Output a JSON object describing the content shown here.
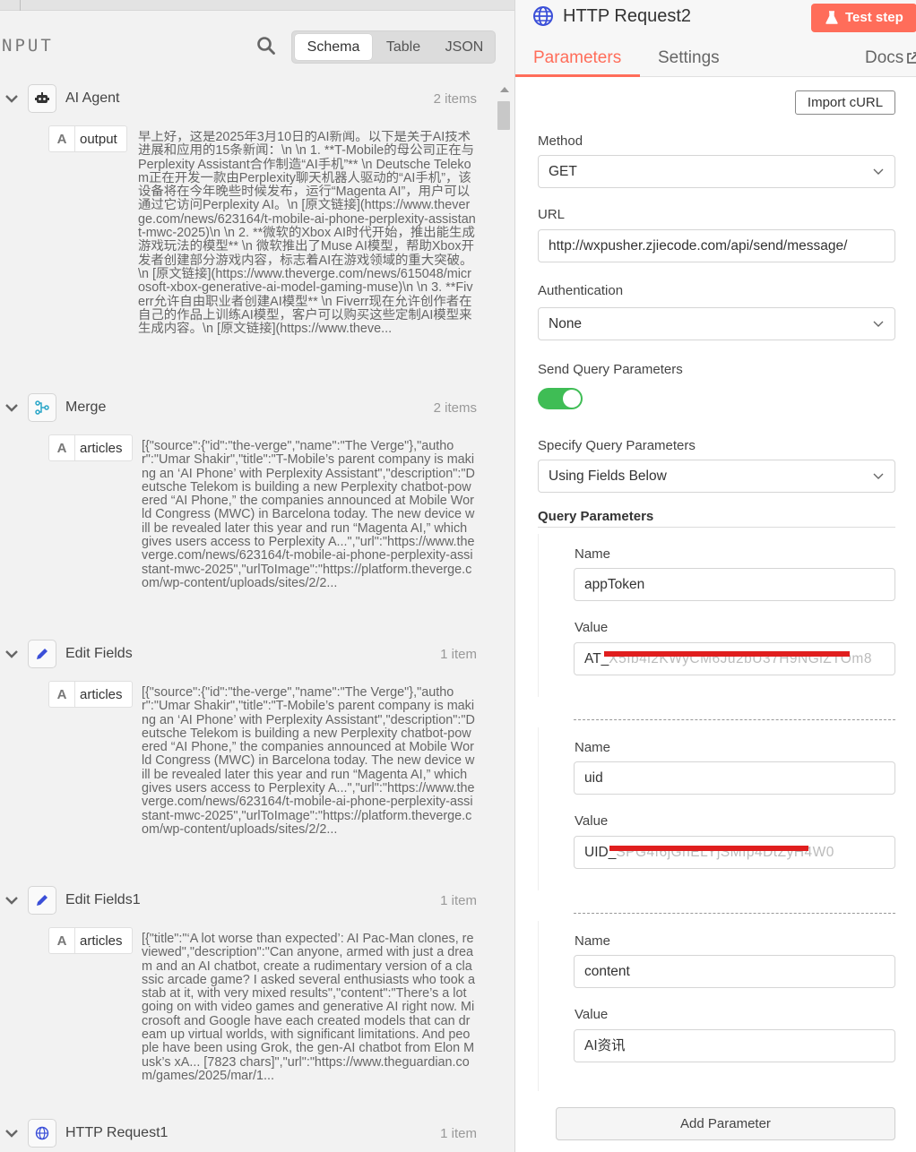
{
  "input_panel": {
    "title": "NPUT",
    "view_tabs": [
      "Schema",
      "Table",
      "JSON"
    ],
    "active_view": "Schema",
    "nodes": [
      {
        "name": "AI Agent",
        "count": "2 items",
        "icon": "robot-icon",
        "field": "output",
        "value": "早上好，这是2025年3月10日的AI新闻。以下是关于AI技术进展和应用的15条新闻：\\n \\n 1. **T-Mobile的母公司正在与Perplexity Assistant合作制造“AI手机”** \\n Deutsche Telekom正在开发一款由Perplexity聊天机器人驱动的“AI手机”，该设备将在今年晚些时候发布，运行“Magenta AI”，用户可以通过它访问Perplexity AI。\\n [原文链接](https://www.theverge.com/news/623164/t-mobile-ai-phone-perplexity-assistant-mwc-2025)\\n \\n 2. **微软的Xbox AI时代开始，推出能生成游戏玩法的模型** \\n 微软推出了Muse AI模型，帮助Xbox开发者创建部分游戏内容，标志着AI在游戏领域的重大突破。\\n [原文链接](https://www.theverge.com/news/615048/microsoft-xbox-generative-ai-model-gaming-muse)\\n \\n 3. **Fiverr允许自由职业者创建AI模型** \\n Fiverr现在允许创作者在自己的作品上训练AI模型，客户可以购买这些定制AI模型来生成内容。\\n [原文链接](https://www.theve..."
      },
      {
        "name": "Merge",
        "count": "2 items",
        "icon": "merge-icon",
        "field": "articles",
        "value": "[{\"source\":{\"id\":\"the-verge\",\"name\":\"The Verge\"},\"author\":\"Umar Shakir\",\"title\":\"T-Mobile’s parent company is making an ‘AI Phone’ with Perplexity Assistant\",\"description\":\"Deutsche Telekom is building a new Perplexity chatbot-powered “AI Phone,” the companies announced at Mobile World Congress (MWC) in Barcelona today. The new device will be revealed later this year and run “Magenta AI,” which gives users access to Perplexity A...\",\"url\":\"https://www.theverge.com/news/623164/t-mobile-ai-phone-perplexity-assistant-mwc-2025\",\"urlToImage\":\"https://platform.theverge.com/wp-content/uploads/sites/2/2..."
      },
      {
        "name": "Edit Fields",
        "count": "1 item",
        "icon": "pencil-icon",
        "field": "articles",
        "value": "[{\"source\":{\"id\":\"the-verge\",\"name\":\"The Verge\"},\"author\":\"Umar Shakir\",\"title\":\"T-Mobile’s parent company is making an ‘AI Phone’ with Perplexity Assistant\",\"description\":\"Deutsche Telekom is building a new Perplexity chatbot-powered “AI Phone,” the companies announced at Mobile World Congress (MWC) in Barcelona today. The new device will be revealed later this year and run “Magenta AI,” which gives users access to Perplexity A...\",\"url\":\"https://www.theverge.com/news/623164/t-mobile-ai-phone-perplexity-assistant-mwc-2025\",\"urlToImage\":\"https://platform.theverge.com/wp-content/uploads/sites/2/2..."
      },
      {
        "name": "Edit Fields1",
        "count": "1 item",
        "icon": "pencil-icon",
        "field": "articles",
        "value": "[{\"title\":\"‘A lot worse than expected’: AI Pac-Man clones, reviewed\",\"description\":\"Can anyone, armed with just a dream and an AI chatbot, create a rudimentary version of a classic arcade game? I asked several enthusiasts who took a stab at it, with very mixed results\",\"content\":\"There’s a lot going on with video games and generative AI right now. Microsoft and Google have each created models that can dream up virtual worlds, with significant limitations. And people have been using Grok, the gen-AI chatbot from Elon Musk’s xA... [7823 chars]\",\"url\":\"https://www.theguardian.com/games/2025/mar/1..."
      },
      {
        "name": "HTTP Request1",
        "count": "1 item",
        "icon": "globe-icon"
      }
    ]
  },
  "node_panel": {
    "title": "HTTP Request2",
    "test_button": "Test step",
    "tabs": [
      "Parameters",
      "Settings",
      "Docs"
    ],
    "active_tab": "Parameters",
    "import_button": "Import cURL",
    "method_label": "Method",
    "method_value": "GET",
    "url_label": "URL",
    "url_value": "http://wxpusher.zjiecode.com/api/send/message/",
    "auth_label": "Authentication",
    "auth_value": "None",
    "send_query_label": "Send Query Parameters",
    "send_query_enabled": true,
    "specify_label": "Specify Query Parameters",
    "specify_value": "Using Fields Below",
    "query_params_label": "Query Parameters",
    "name_label": "Name",
    "value_label": "Value",
    "params": [
      {
        "name": "appToken",
        "value_prefix": "AT_",
        "value_masked": "X5Ib4i2KWyCM6Ju2bU37H9NGiZTOm8"
      },
      {
        "name": "uid",
        "value_prefix": "UID_",
        "value_masked": "SPG4f6jGnELYjSMIp4DtZyH4W0"
      },
      {
        "name": "content",
        "value_prefix": "AI资讯",
        "value_masked": ""
      }
    ],
    "add_param_button": "Add Parameter",
    "colors": {
      "accent": "#ff6d5a",
      "toggle_on": "#3fbd55",
      "redaction": "#e01e1e"
    }
  }
}
